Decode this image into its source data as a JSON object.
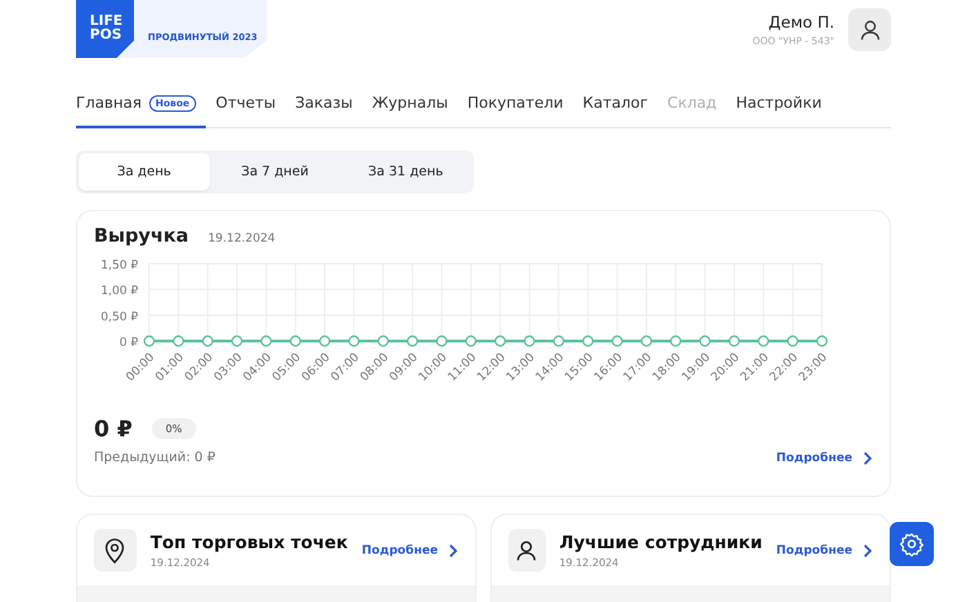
{
  "logo": {
    "line_1": "LIFE",
    "line_2": "POS",
    "plan": "ПРОДВИНУТЫЙ 2023"
  },
  "user": {
    "name": "Демо П.",
    "company": "ООО \"УНР - 543\""
  },
  "tabs": [
    {
      "label": "Главная",
      "badge": "Новое",
      "selected": true,
      "disabled": false
    },
    {
      "label": "Отчеты",
      "selected": false,
      "disabled": false
    },
    {
      "label": "Заказы",
      "selected": false,
      "disabled": false
    },
    {
      "label": "Журналы",
      "selected": false,
      "disabled": false
    },
    {
      "label": "Покупатели",
      "selected": false,
      "disabled": false
    },
    {
      "label": "Каталог",
      "selected": false,
      "disabled": false
    },
    {
      "label": "Склад",
      "selected": false,
      "disabled": true
    },
    {
      "label": "Настройки",
      "selected": false,
      "disabled": false
    }
  ],
  "periods": [
    {
      "label": "За день",
      "selected": true
    },
    {
      "label": "За 7 дней",
      "selected": false
    },
    {
      "label": "За 31 день",
      "selected": false
    }
  ],
  "revenue": {
    "title": "Выручка",
    "date": "19.12.2024",
    "total": "0 ₽",
    "change": "0%",
    "previous": "Предыдущий: 0 ₽",
    "more": "Подробнее",
    "chart_data": {
      "type": "line",
      "categories": [
        "00:00",
        "01:00",
        "02:00",
        "03:00",
        "04:00",
        "05:00",
        "06:00",
        "07:00",
        "08:00",
        "09:00",
        "10:00",
        "11:00",
        "12:00",
        "13:00",
        "14:00",
        "15:00",
        "16:00",
        "17:00",
        "18:00",
        "19:00",
        "20:00",
        "21:00",
        "22:00",
        "23:00"
      ],
      "grid": true,
      "series": [
        {
          "color": "#5cc49a",
          "marker": true,
          "values": [
            0,
            0,
            0,
            0,
            0,
            0,
            0,
            0,
            0,
            0,
            0,
            0,
            0,
            0,
            0,
            0,
            0,
            0,
            0,
            0,
            0,
            0,
            0,
            0
          ]
        }
      ],
      "ylim": [
        0,
        1.5
      ],
      "yticks": [
        {
          "value": 0,
          "label": "0 ₽"
        },
        {
          "value": 0.5,
          "label": "0,50 ₽"
        },
        {
          "value": 1,
          "label": "1,00 ₽"
        },
        {
          "value": 1.5,
          "label": "1,50 ₽"
        }
      ]
    }
  },
  "cards": [
    {
      "kind": "location",
      "title": "Топ торговых точек",
      "date": "19.12.2024",
      "more": "Подробнее"
    },
    {
      "kind": "person",
      "title": "Лучшие сотрудники",
      "date": "19.12.2024",
      "more": "Подробнее"
    }
  ]
}
